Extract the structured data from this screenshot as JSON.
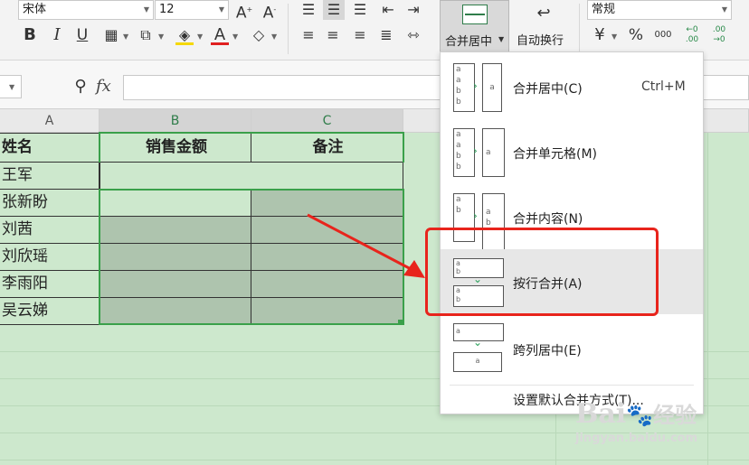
{
  "ribbon": {
    "font_name": "宋体",
    "font_size": "12",
    "merge_label": "合并居中",
    "wrap_label": "自动换行",
    "number_format": "常规",
    "bold": "B",
    "italic": "I",
    "underline": "U",
    "font_color_char": "A",
    "percent": "%",
    "thousands": "000",
    "dec_inc": "←0 .00",
    "dec_dec": ".00 →0"
  },
  "formula_bar": {
    "fx": "fx"
  },
  "columns": [
    "A",
    "B",
    "C"
  ],
  "table": {
    "headers": [
      "姓名",
      "销售金额",
      "备注"
    ],
    "rows": [
      "王军",
      "张新盼",
      "刘茜",
      "刘欣瑶",
      "李雨阳",
      "吴云娣"
    ]
  },
  "merge_menu": {
    "items": [
      {
        "label": "合并居中(C)",
        "shortcut": "Ctrl+M"
      },
      {
        "label": "合并单元格(M)",
        "shortcut": ""
      },
      {
        "label": "合并内容(N)",
        "shortcut": ""
      },
      {
        "label": "按行合并(A)",
        "shortcut": ""
      },
      {
        "label": "跨列居中(E)",
        "shortcut": ""
      }
    ],
    "footer": "设置默认合并方式(T)..."
  },
  "watermark": {
    "brand": "Bai",
    "brand2": "经验",
    "url": "jingyan.baidu.com"
  },
  "colors": {
    "highlight_red": "#e8241c",
    "sheet_green": "#cde8cd",
    "selection_green": "#3aa04a"
  }
}
